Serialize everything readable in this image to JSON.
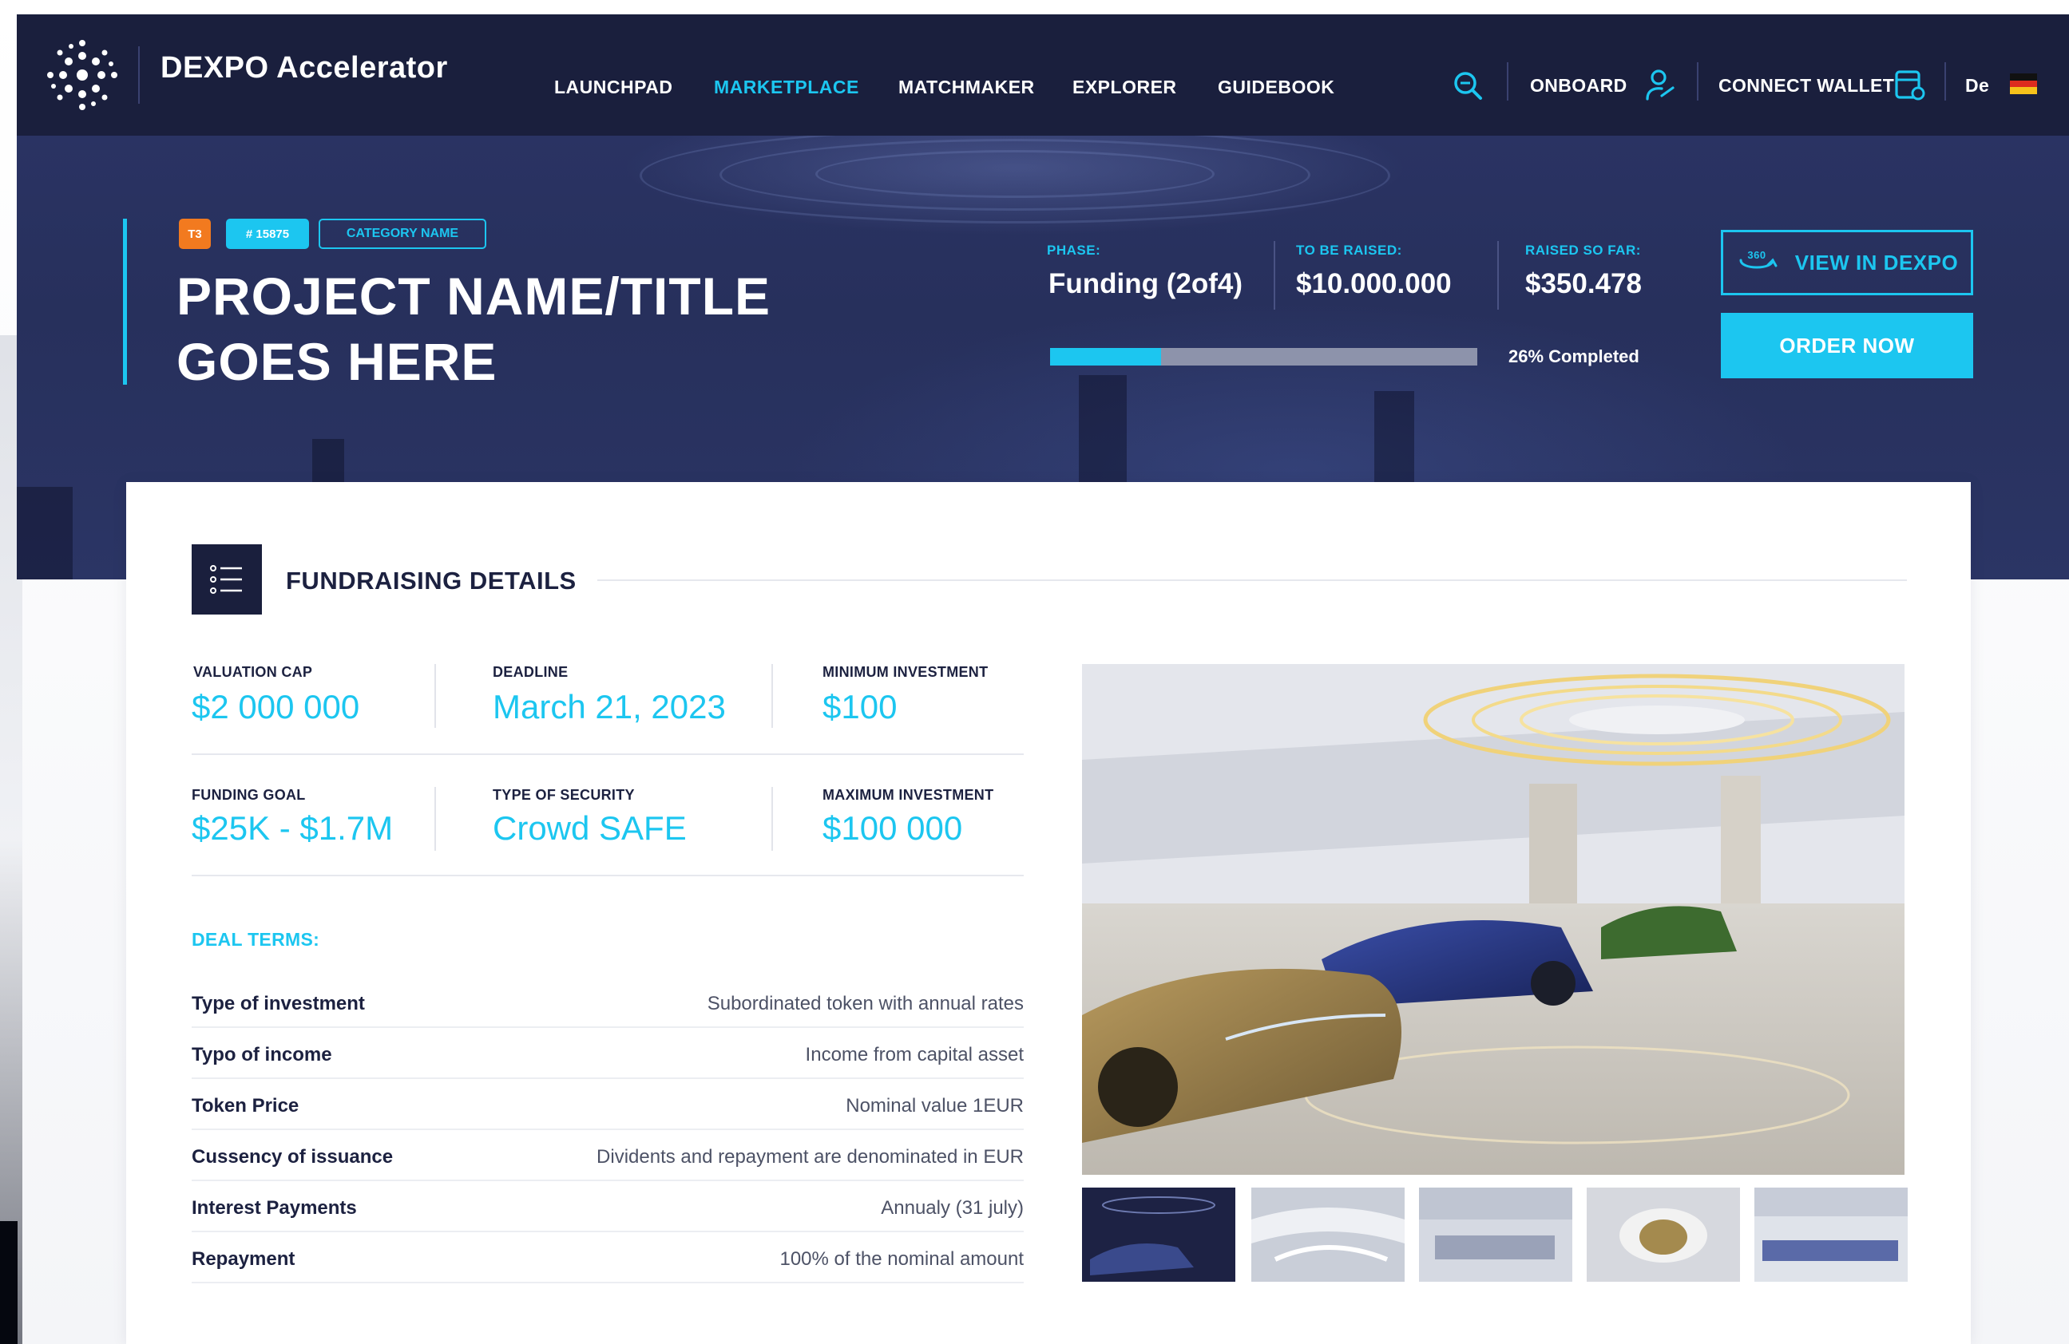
{
  "app": {
    "brand": "DEXPO Accelerator"
  },
  "nav": {
    "links": [
      "LAUNCHPAD",
      "MARKETPLACE",
      "MATCHMAKER",
      "EXPLORER",
      "GUIDEBOOK"
    ],
    "active": "MARKETPLACE",
    "onboard_label": "ONBOARD",
    "wallet_label": "CONNECT WALLET",
    "language": "De"
  },
  "project": {
    "tier_badge": "T3",
    "id_badge": "# 15875",
    "category_badge": "CATEGORY NAME",
    "title_line1": "PROJECT NAME/TITLE",
    "title_line2": "GOES HERE"
  },
  "stats": {
    "phase_label": "PHASE:",
    "phase_value": "Funding (2of4)",
    "to_raise_label": "TO BE RAISED:",
    "to_raise_value": "$10.000.000",
    "raised_label": "RAISED SO FAR:",
    "raised_value": "$350.478",
    "progress_percent": 26,
    "progress_text": "26%  Completed"
  },
  "actions": {
    "view_badge": "360",
    "view_label": "VIEW IN DEXPO",
    "order_label": "ORDER NOW"
  },
  "fundraising": {
    "title": "FUNDRAISING DETAILS",
    "metrics": [
      {
        "label": "VALUATION CAP",
        "value": "$2 000 000"
      },
      {
        "label": "DEADLINE",
        "value": "March 21, 2023"
      },
      {
        "label": "MINIMUM INVESTMENT",
        "value": "$100"
      },
      {
        "label": "FUNDING GOAL",
        "value": "$25K - $1.7M"
      },
      {
        "label": "TYPE OF SECURITY",
        "value": "Crowd SAFE"
      },
      {
        "label": "MAXIMUM INVESTMENT",
        "value": "$100 000"
      }
    ],
    "deal_terms_heading": "DEAL TERMS:",
    "deal_terms": [
      {
        "key": "Type of investment",
        "value": "Subordinated token with annual rates"
      },
      {
        "key": "Typo of income",
        "value": "Income from capital asset"
      },
      {
        "key": "Token Price",
        "value": "Nominal value 1EUR"
      },
      {
        "key": "Cussency of issuance",
        "value": "Dividents and repayment are denominated in EUR"
      },
      {
        "key": "Interest Payments",
        "value": "Annualy (31 july)"
      },
      {
        "key": "Repayment",
        "value": "100% of the nominal amount"
      }
    ]
  },
  "colors": {
    "accent": "#1cc6f0",
    "navy": "#1a1f3d",
    "tier_orange": "#f27a1f"
  },
  "icons": [
    "search-icon",
    "user-onboard-icon",
    "wallet-icon",
    "german-flag-icon",
    "list-icon",
    "view-360-icon"
  ]
}
